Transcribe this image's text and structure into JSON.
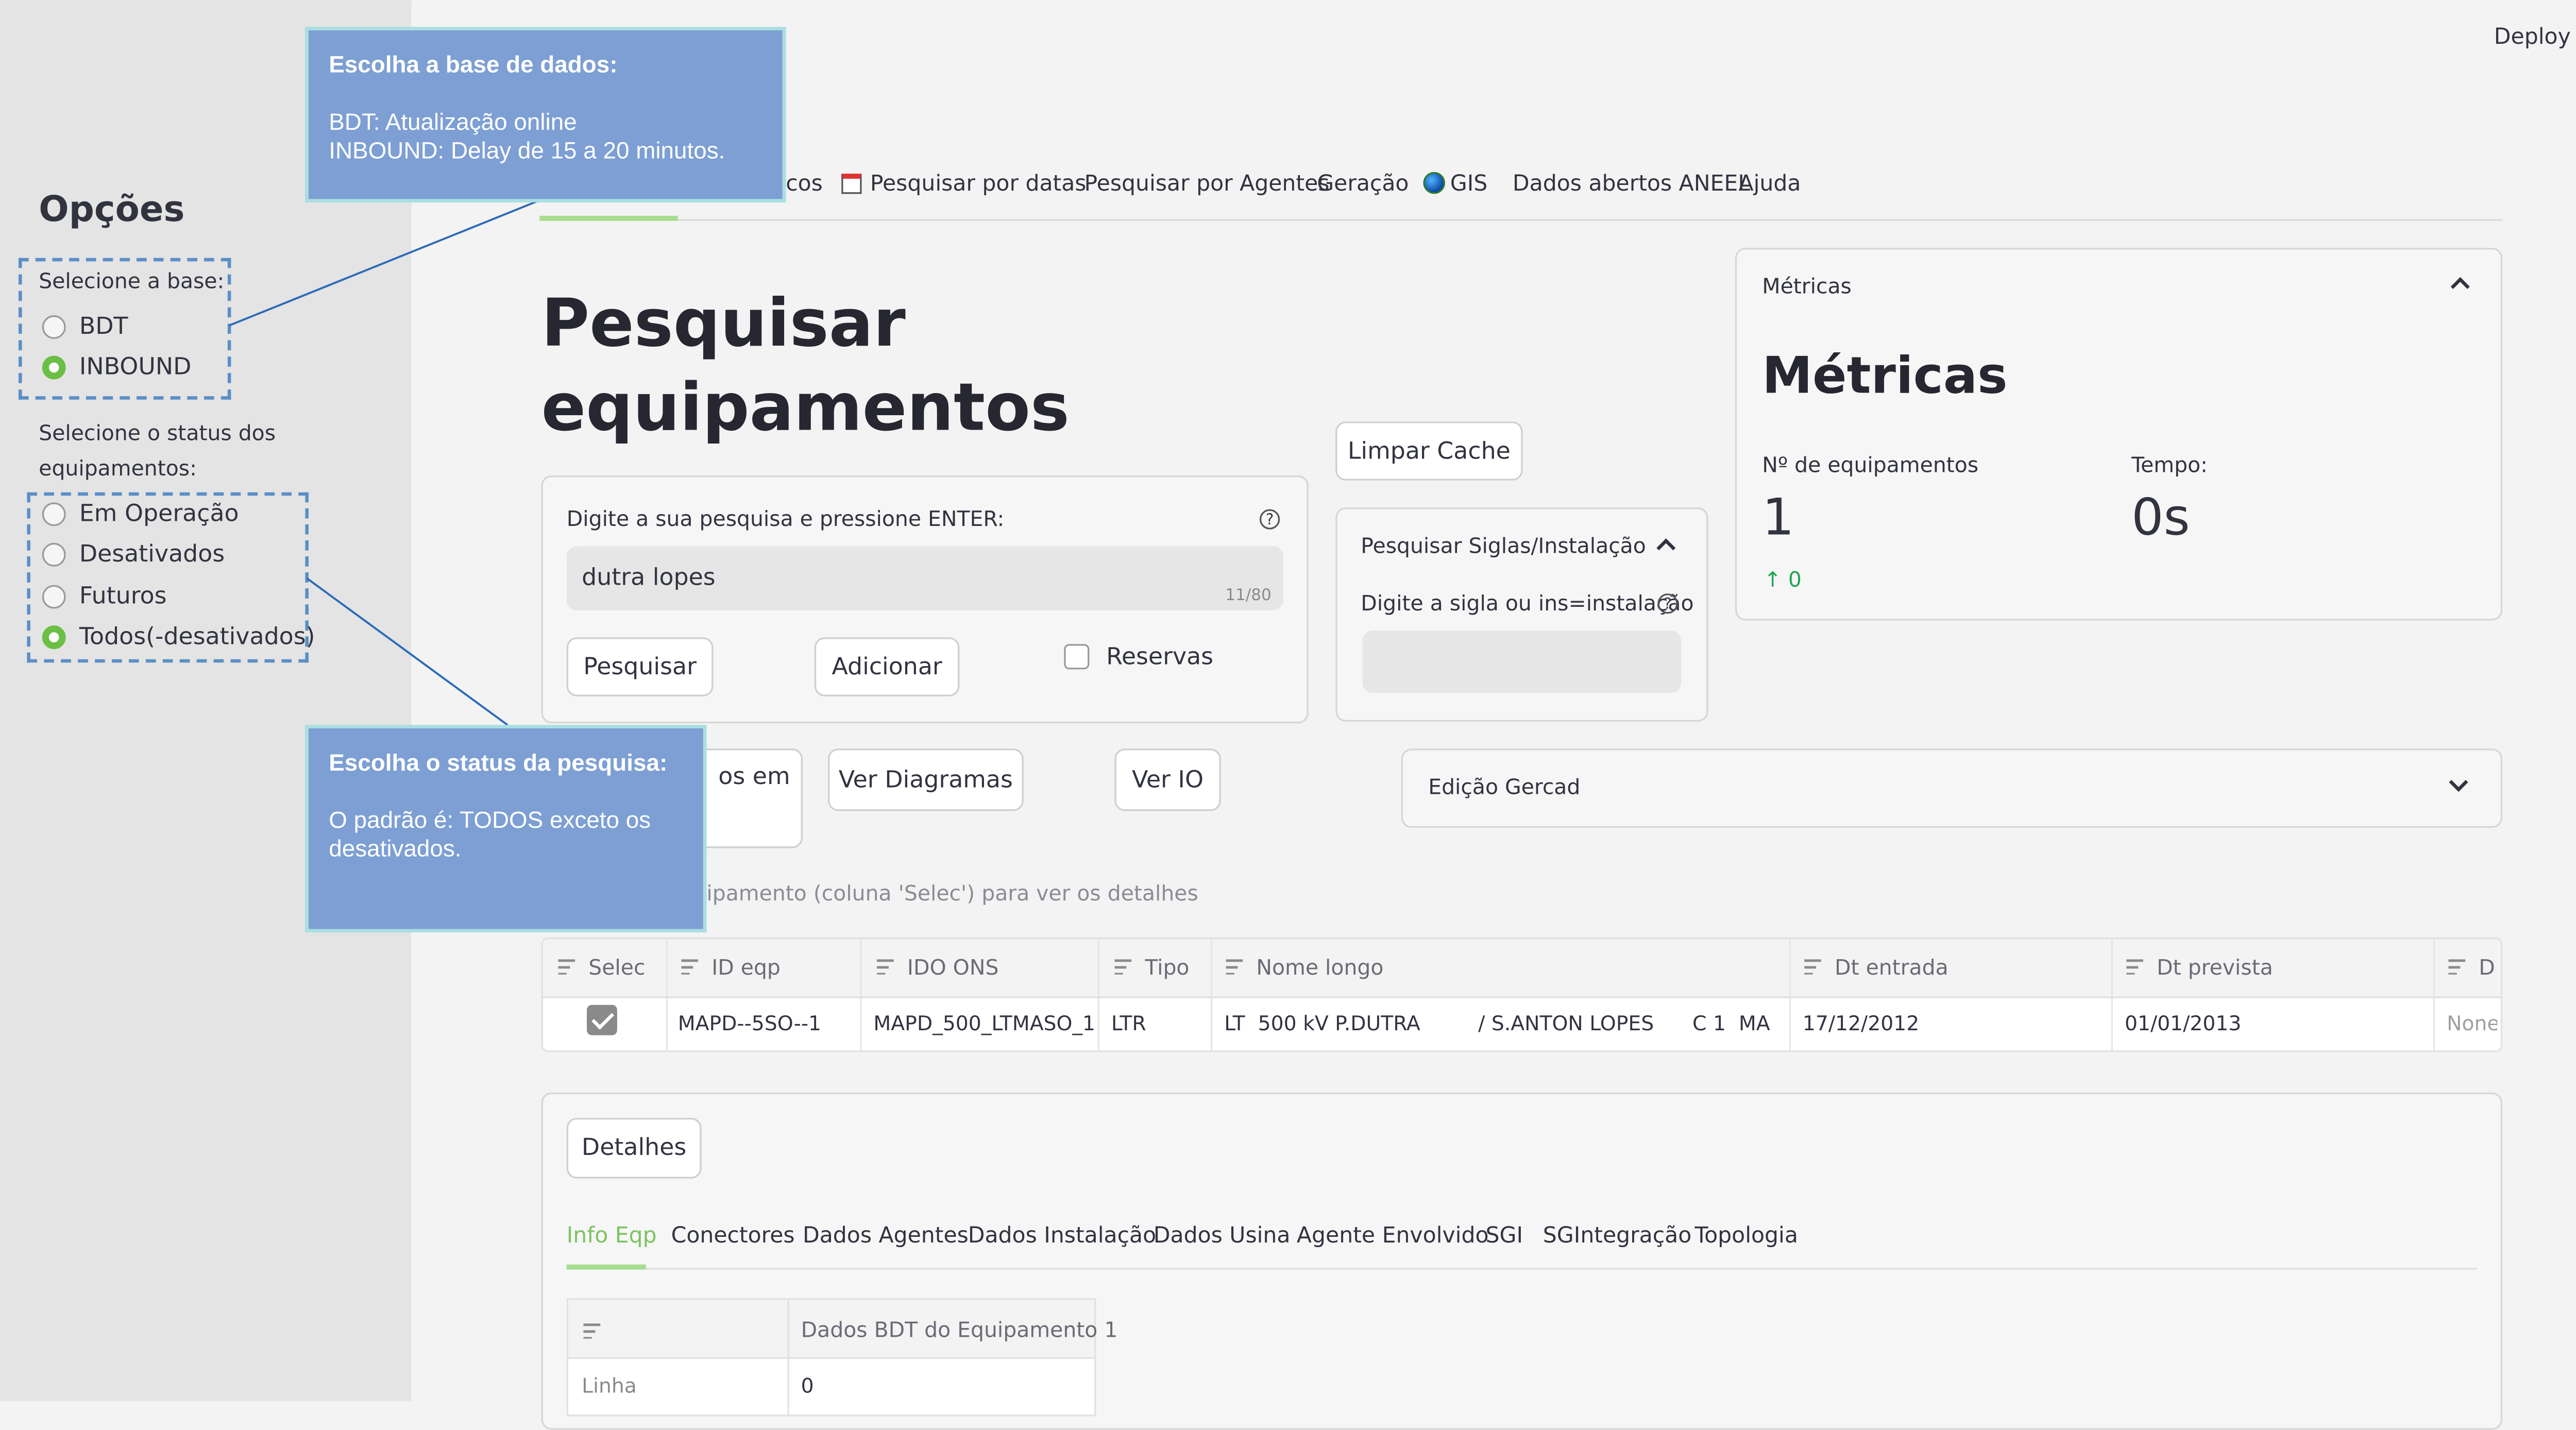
{
  "header": {
    "deploy_label": "Deploy",
    "menu_icon": "kebab-menu-icon"
  },
  "sidebar": {
    "title": "Opções",
    "base_label": "Selecione a base:",
    "base_options": [
      "BDT",
      "INBOUND"
    ],
    "base_selected": "INBOUND",
    "status_label_line1": "Selecione o status dos",
    "status_label_line2": "equipamentos:",
    "status_options": [
      "Em Operação",
      "Desativados",
      "Futuros",
      "Todos(-desativados)"
    ],
    "status_selected": "Todos(-desativados)"
  },
  "nav": {
    "partial_first": "cos",
    "items": [
      "Pesquisar por datas",
      "Pesquisar por Agentes",
      "Geração",
      "GIS",
      "Dados abertos ANEEL",
      "Ajuda"
    ]
  },
  "page": {
    "title_line1": "Pesquisar",
    "title_line2": "equipamentos"
  },
  "search": {
    "label": "Digite a sua pesquisa e pressione ENTER:",
    "value": "dutra lopes",
    "counter": "11/80",
    "search_button": "Pesquisar",
    "add_button": "Adicionar",
    "reserve_label": "Reservas",
    "help": "?"
  },
  "limpar_cache": "Limpar Cache",
  "siglas": {
    "title": "Pesquisar Siglas/Instalação",
    "label": "Digite a sigla ou ins=instalação",
    "value": ""
  },
  "metrics": {
    "expander_title": "Métricas",
    "heading": "Métricas",
    "equip_label": "Nº de equipamentos",
    "equip_value": "1",
    "equip_delta": "0",
    "time_label": "Tempo:",
    "time_value": "0s"
  },
  "actions": {
    "partial_button": "os em",
    "diagrams_button": "Ver Diagramas",
    "io_button": "Ver IO",
    "gercad_title": "Edição Gercad"
  },
  "hint": "ipamento (coluna 'Selec') para ver os detalhes",
  "table": {
    "headers": [
      "Selec",
      "ID eqp",
      "IDO ONS",
      "Tipo",
      "Nome longo",
      "Dt entrada",
      "Dt prevista",
      "D"
    ],
    "row": [
      "",
      "MAPD--5SO--1",
      "MAPD_500_LTMASO_1",
      "LTR",
      "LT  500 kV P.DUTRA         / S.ANTON LOPES      C 1  MA",
      "17/12/2012",
      "01/01/2013",
      "None"
    ]
  },
  "details": {
    "button": "Detalhes",
    "tabs": [
      "Info Eqp",
      "Conectores",
      "Dados Agentes",
      "Dados Instalação",
      "Dados Usina",
      "Agente Envolvido",
      "SGI",
      "SGIntegração",
      "Topologia"
    ],
    "active_tab": "Info Eqp",
    "table_header": "Dados BDT do Equipamento 1",
    "row_label": "Linha",
    "row_value": "0"
  },
  "callouts": {
    "base": {
      "title": "Escolha a base de dados:",
      "line1": "BDT: Atualização online",
      "line2": "INBOUND: Delay de 15 a 20 minutos."
    },
    "status": {
      "title": "Escolha o status da pesquisa:",
      "line1": "O padrão é: TODOS exceto os desativados."
    }
  },
  "colors": {
    "accent_green": "#6abf45",
    "callout_blue": "#7d9fd3",
    "tab_active": "#7cc461",
    "delta_green": "#21a652"
  }
}
